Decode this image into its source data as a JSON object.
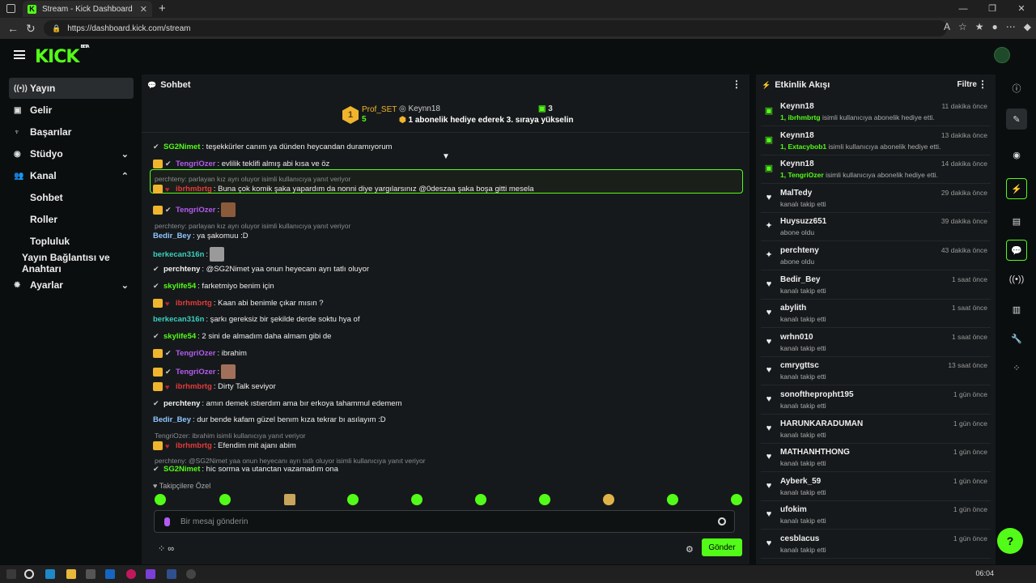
{
  "browser": {
    "tab_title": "Stream - Kick Dashboard",
    "url": "https://dashboard.kick.com/stream"
  },
  "brand": {
    "logo": "KICK",
    "badge": "BETA",
    "accent": "#53fc18"
  },
  "sidebar": {
    "items": [
      {
        "label": "Yayın",
        "icon": "broadcast-icon"
      },
      {
        "label": "Gelir",
        "icon": "revenue-icon"
      },
      {
        "label": "Başarılar",
        "icon": "trophy-icon"
      },
      {
        "label": "Stüdyo",
        "icon": "camera-icon"
      },
      {
        "label": "Kanal",
        "icon": "people-icon"
      },
      {
        "label": "Sohbet"
      },
      {
        "label": "Roller"
      },
      {
        "label": "Topluluk"
      },
      {
        "label": "Yayın Bağlantısı ve Anahtarı"
      },
      {
        "label": "Ayarlar",
        "icon": "gear-icon"
      }
    ]
  },
  "chat": {
    "title": "Sohbet",
    "pinned": {
      "rank": "1",
      "top_user": "Prof_SET",
      "top_count": "5",
      "gifter": "Keynn18",
      "gift_count": "3",
      "message": "1 abonelik hediye ederek 3. sıraya yükselin"
    },
    "messages": [
      {
        "user": "SG2Nimet",
        "text": ": teşekkürler canım ya dünden heycandan duramıyorum"
      },
      {
        "user": "TengriOzer",
        "text": ": evlilik teklifi almış abi kısa ve öz"
      },
      {
        "reply": "perchteny: parlayan kız ayrı oluyor isimli kullanıcıya yanıt veriyor"
      },
      {
        "user": "ibrhmbrtg",
        "text": ": Buna çok komik şaka yapardım da nonni diye yargılarsınız @0deszaa şaka boşa gitti mesela"
      },
      {
        "user": "TengriOzer",
        "text": ":"
      },
      {
        "reply": "perchteny: parlayan kız ayrı oluyor isimli kullanıcıya yanıt veriyor"
      },
      {
        "user": "Bedir_Bey",
        "text": ": ya şakomuu :D"
      },
      {
        "user": "berkecan316n",
        "text": ":"
      },
      {
        "user": "perchteny",
        "text": ": @SG2Nimet yaa onun heyecanı ayrı tatlı oluyor"
      },
      {
        "user": "skylife54",
        "text": ": farketmiyo benim için"
      },
      {
        "user": "ibrhmbrtg",
        "text": ": Kaan abi benimle çıkar mısın ?"
      },
      {
        "user": "berkecan316n",
        "text": ": şarkı gereksiz bir şekilde derde soktu hya of"
      },
      {
        "user": "skylife54",
        "text": ": 2 sini de almadım daha almam gibi de"
      },
      {
        "user": "TengriOzer",
        "text": ": ibrahim"
      },
      {
        "user": "TengriOzer",
        "text": ":"
      },
      {
        "user": "ibrhmbrtg",
        "text": ": Dirty Talk seviyor"
      },
      {
        "user": "perchteny",
        "text": ": amın demek ıstıerdım ama bır erkoya tahammul edemem"
      },
      {
        "user": "Bedir_Bey",
        "text": ": dur bende kafam güzel benım kıza tekrar bı asılayım :D"
      },
      {
        "reply": "TengriOzer: ibrahim isimli kullanıcıya yanıt veriyor"
      },
      {
        "user": "ibrhmbrtg",
        "text": ": Efendim mit ajanı abim"
      },
      {
        "reply": "perchteny: @SG2Nimet yaa onun heyecanı ayrı tatlı oluyor isimli kullanıcıya yanıt veriyor"
      },
      {
        "user": "SG2Nimet",
        "text": ": hiç sorma ya utançtan yazamadım ona"
      }
    ],
    "followers_only": "Takipçilere Özel",
    "input_placeholder": "Bir mesaj gönderin",
    "send_label": "Gönder"
  },
  "events": {
    "title": "Etkinlik Akışı",
    "filter_label": "Filtre",
    "items": [
      {
        "name": "Keynn18",
        "prefix": "1, ibrhmbrtg",
        "desc": " isimli kullanıcıya abonelik hediye etti.",
        "time": "11 dakika önce",
        "icon": "gift-icon"
      },
      {
        "name": "Keynn18",
        "prefix": "1, Extacybob1",
        "desc": " isimli kullanıcıya abonelik hediye etti.",
        "time": "13 dakika önce",
        "icon": "gift-icon"
      },
      {
        "name": "Keynn18",
        "prefix": "1, TengriOzer",
        "desc": " isimli kullanıcıya abonelik hediye etti.",
        "time": "14 dakika önce",
        "icon": "gift-icon"
      },
      {
        "name": "MalTedy",
        "prefix": "",
        "desc": "kanalı takip etti",
        "time": "29 dakika önce",
        "icon": "heart-icon"
      },
      {
        "name": "Huysuzz651",
        "prefix": "",
        "desc": "abone oldu",
        "time": "39 dakika önce",
        "icon": "sparkle-icon"
      },
      {
        "name": "perchteny",
        "prefix": "",
        "desc": "abone oldu",
        "time": "43 dakika önce",
        "icon": "sparkle-icon"
      },
      {
        "name": "Bedir_Bey",
        "prefix": "",
        "desc": "kanalı takip etti",
        "time": "1 saat önce",
        "icon": "heart-icon"
      },
      {
        "name": "abylith",
        "prefix": "",
        "desc": "kanalı takip etti",
        "time": "1 saat önce",
        "icon": "heart-icon"
      },
      {
        "name": "wrhn010",
        "prefix": "",
        "desc": "kanalı takip etti",
        "time": "1 saat önce",
        "icon": "heart-icon"
      },
      {
        "name": "cmrygttsc",
        "prefix": "",
        "desc": "kanalı takip etti",
        "time": "13 saat önce",
        "icon": "heart-icon"
      },
      {
        "name": "sonoftheproph​t195",
        "prefix": "",
        "desc": "kanalı takip etti",
        "time": "1 gün önce",
        "icon": "heart-icon"
      },
      {
        "name": "HARUNKARADUMAN",
        "prefix": "",
        "desc": "kanalı takip etti",
        "time": "1 gün önce",
        "icon": "heart-icon"
      },
      {
        "name": "MATHANHTHONG",
        "prefix": "",
        "desc": "kanalı takip etti",
        "time": "1 gün önce",
        "icon": "heart-icon"
      },
      {
        "name": "Ayberk_59",
        "prefix": "",
        "desc": "kanalı takip etti",
        "time": "1 gün önce",
        "icon": "heart-icon"
      },
      {
        "name": "ufokim",
        "prefix": "",
        "desc": "kanalı takip etti",
        "time": "1 gün önce",
        "icon": "heart-icon"
      },
      {
        "name": "cesblacus",
        "prefix": "",
        "desc": "kanalı takip etti",
        "time": "1 gün önce",
        "icon": "heart-icon"
      }
    ]
  },
  "taskbar": {
    "clock": "06:04"
  }
}
